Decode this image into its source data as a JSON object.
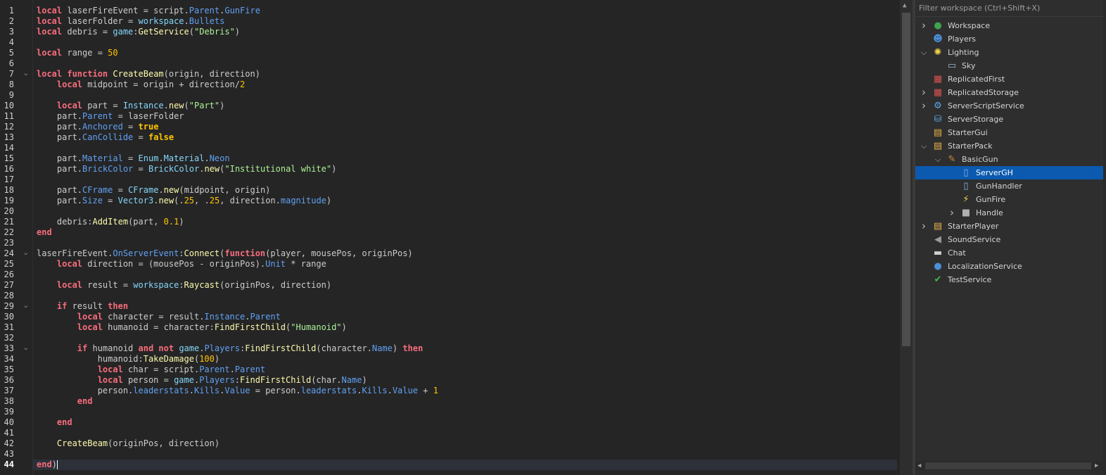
{
  "editor": {
    "current_line": 44,
    "lines": [
      {
        "n": 1,
        "code": [
          [
            "kw",
            "local"
          ],
          [
            "op",
            " laserFireEvent = script."
          ],
          [
            "prop",
            "Parent"
          ],
          [
            "op",
            "."
          ],
          [
            "prop",
            "GunFire"
          ]
        ]
      },
      {
        "n": 2,
        "code": [
          [
            "kw",
            "local"
          ],
          [
            "op",
            " laserFolder = "
          ],
          [
            "builtin",
            "workspace"
          ],
          [
            "op",
            "."
          ],
          [
            "prop",
            "Bullets"
          ]
        ]
      },
      {
        "n": 3,
        "code": [
          [
            "kw",
            "local"
          ],
          [
            "op",
            " debris = "
          ],
          [
            "builtin",
            "game"
          ],
          [
            "op",
            ":"
          ],
          [
            "fn",
            "GetService"
          ],
          [
            "op",
            "("
          ],
          [
            "str",
            "\"Debris\""
          ],
          [
            "op",
            ")"
          ]
        ]
      },
      {
        "n": 4,
        "code": []
      },
      {
        "n": 5,
        "code": [
          [
            "kw",
            "local"
          ],
          [
            "op",
            " range = "
          ],
          [
            "num",
            "50"
          ]
        ]
      },
      {
        "n": 6,
        "code": []
      },
      {
        "n": 7,
        "fold": true,
        "code": [
          [
            "kw",
            "local function"
          ],
          [
            "op",
            " "
          ],
          [
            "fn",
            "CreateBeam"
          ],
          [
            "op",
            "(origin, direction)"
          ]
        ]
      },
      {
        "n": 8,
        "code": [
          [
            "op",
            "    "
          ],
          [
            "kw",
            "local"
          ],
          [
            "op",
            " midpoint = origin + direction/"
          ],
          [
            "num",
            "2"
          ]
        ]
      },
      {
        "n": 9,
        "code": []
      },
      {
        "n": 10,
        "code": [
          [
            "op",
            "    "
          ],
          [
            "kw",
            "local"
          ],
          [
            "op",
            " part = "
          ],
          [
            "builtin",
            "Instance"
          ],
          [
            "op",
            "."
          ],
          [
            "fn",
            "new"
          ],
          [
            "op",
            "("
          ],
          [
            "str",
            "\"Part\""
          ],
          [
            "op",
            ")"
          ]
        ]
      },
      {
        "n": 11,
        "code": [
          [
            "op",
            "    part."
          ],
          [
            "prop",
            "Parent"
          ],
          [
            "op",
            " = laserFolder"
          ]
        ]
      },
      {
        "n": 12,
        "code": [
          [
            "op",
            "    part."
          ],
          [
            "prop",
            "Anchored"
          ],
          [
            "op",
            " = "
          ],
          [
            "bool",
            "true"
          ]
        ]
      },
      {
        "n": 13,
        "code": [
          [
            "op",
            "    part."
          ],
          [
            "prop",
            "CanCollide"
          ],
          [
            "op",
            " = "
          ],
          [
            "bool",
            "false"
          ]
        ]
      },
      {
        "n": 14,
        "code": []
      },
      {
        "n": 15,
        "code": [
          [
            "op",
            "    part."
          ],
          [
            "prop",
            "Material"
          ],
          [
            "op",
            " = "
          ],
          [
            "builtin",
            "Enum"
          ],
          [
            "op",
            "."
          ],
          [
            "builtin",
            "Material"
          ],
          [
            "op",
            "."
          ],
          [
            "prop",
            "Neon"
          ]
        ]
      },
      {
        "n": 16,
        "code": [
          [
            "op",
            "    part."
          ],
          [
            "prop",
            "BrickColor"
          ],
          [
            "op",
            " = "
          ],
          [
            "builtin",
            "BrickColor"
          ],
          [
            "op",
            "."
          ],
          [
            "fn",
            "new"
          ],
          [
            "op",
            "("
          ],
          [
            "str",
            "\"Institutional white\""
          ],
          [
            "op",
            ")"
          ]
        ]
      },
      {
        "n": 17,
        "code": []
      },
      {
        "n": 18,
        "code": [
          [
            "op",
            "    part."
          ],
          [
            "prop",
            "CFrame"
          ],
          [
            "op",
            " = "
          ],
          [
            "builtin",
            "CFrame"
          ],
          [
            "op",
            "."
          ],
          [
            "fn",
            "new"
          ],
          [
            "op",
            "(midpoint, origin)"
          ]
        ]
      },
      {
        "n": 19,
        "code": [
          [
            "op",
            "    part."
          ],
          [
            "prop",
            "Size"
          ],
          [
            "op",
            " = "
          ],
          [
            "builtin",
            "Vector3"
          ],
          [
            "op",
            "."
          ],
          [
            "fn",
            "new"
          ],
          [
            "op",
            "(."
          ],
          [
            "num",
            "25"
          ],
          [
            "op",
            ", ."
          ],
          [
            "num",
            "25"
          ],
          [
            "op",
            ", direction."
          ],
          [
            "prop",
            "magnitude"
          ],
          [
            "op",
            ")"
          ]
        ]
      },
      {
        "n": 20,
        "code": []
      },
      {
        "n": 21,
        "code": [
          [
            "op",
            "    debris:"
          ],
          [
            "fn",
            "AddItem"
          ],
          [
            "op",
            "(part, "
          ],
          [
            "num",
            "0.1"
          ],
          [
            "op",
            ")"
          ]
        ]
      },
      {
        "n": 22,
        "code": [
          [
            "kw",
            "end"
          ]
        ]
      },
      {
        "n": 23,
        "code": []
      },
      {
        "n": 24,
        "fold": true,
        "code": [
          [
            "op",
            "laserFireEvent."
          ],
          [
            "prop",
            "OnServerEvent"
          ],
          [
            "op",
            ":"
          ],
          [
            "fn",
            "Connect"
          ],
          [
            "op",
            "("
          ],
          [
            "kw",
            "function"
          ],
          [
            "op",
            "(player, mousePos, originPos)"
          ]
        ]
      },
      {
        "n": 25,
        "code": [
          [
            "op",
            "    "
          ],
          [
            "kw",
            "local"
          ],
          [
            "op",
            " direction = (mousePos - originPos)."
          ],
          [
            "prop",
            "Unit"
          ],
          [
            "op",
            " * range"
          ]
        ]
      },
      {
        "n": 26,
        "code": []
      },
      {
        "n": 27,
        "code": [
          [
            "op",
            "    "
          ],
          [
            "kw",
            "local"
          ],
          [
            "op",
            " result = "
          ],
          [
            "builtin",
            "workspace"
          ],
          [
            "op",
            ":"
          ],
          [
            "fn",
            "Raycast"
          ],
          [
            "op",
            "(originPos, direction)"
          ]
        ]
      },
      {
        "n": 28,
        "code": []
      },
      {
        "n": 29,
        "fold": true,
        "code": [
          [
            "op",
            "    "
          ],
          [
            "kw",
            "if"
          ],
          [
            "op",
            " result "
          ],
          [
            "kw",
            "then"
          ]
        ]
      },
      {
        "n": 30,
        "code": [
          [
            "op",
            "        "
          ],
          [
            "kw",
            "local"
          ],
          [
            "op",
            " character = result."
          ],
          [
            "prop",
            "Instance"
          ],
          [
            "op",
            "."
          ],
          [
            "prop",
            "Parent"
          ]
        ]
      },
      {
        "n": 31,
        "code": [
          [
            "op",
            "        "
          ],
          [
            "kw",
            "local"
          ],
          [
            "op",
            " humanoid = character:"
          ],
          [
            "fn",
            "FindFirstChild"
          ],
          [
            "op",
            "("
          ],
          [
            "str",
            "\"Humanoid\""
          ],
          [
            "op",
            ")"
          ]
        ]
      },
      {
        "n": 32,
        "code": []
      },
      {
        "n": 33,
        "fold": true,
        "code": [
          [
            "op",
            "        "
          ],
          [
            "kw",
            "if"
          ],
          [
            "op",
            " humanoid "
          ],
          [
            "kw",
            "and not"
          ],
          [
            "op",
            " "
          ],
          [
            "builtin",
            "game"
          ],
          [
            "op",
            "."
          ],
          [
            "prop",
            "Players"
          ],
          [
            "op",
            ":"
          ],
          [
            "fn",
            "FindFirstChild"
          ],
          [
            "op",
            "(character."
          ],
          [
            "prop",
            "Name"
          ],
          [
            "op",
            ") "
          ],
          [
            "kw",
            "then"
          ]
        ]
      },
      {
        "n": 34,
        "code": [
          [
            "op",
            "            humanoid:"
          ],
          [
            "fn",
            "TakeDamage"
          ],
          [
            "op",
            "("
          ],
          [
            "num",
            "100"
          ],
          [
            "op",
            ")"
          ]
        ]
      },
      {
        "n": 35,
        "code": [
          [
            "op",
            "            "
          ],
          [
            "kw",
            "local"
          ],
          [
            "op",
            " char = script."
          ],
          [
            "prop",
            "Parent"
          ],
          [
            "op",
            "."
          ],
          [
            "prop",
            "Parent"
          ]
        ]
      },
      {
        "n": 36,
        "code": [
          [
            "op",
            "            "
          ],
          [
            "kw",
            "local"
          ],
          [
            "op",
            " person = "
          ],
          [
            "builtin",
            "game"
          ],
          [
            "op",
            "."
          ],
          [
            "prop",
            "Players"
          ],
          [
            "op",
            ":"
          ],
          [
            "fn",
            "FindFirstChild"
          ],
          [
            "op",
            "(char."
          ],
          [
            "prop",
            "Name"
          ],
          [
            "op",
            ")"
          ]
        ]
      },
      {
        "n": 37,
        "code": [
          [
            "op",
            "            person."
          ],
          [
            "prop",
            "leaderstats"
          ],
          [
            "op",
            "."
          ],
          [
            "prop",
            "Kills"
          ],
          [
            "op",
            "."
          ],
          [
            "prop",
            "Value"
          ],
          [
            "op",
            " = person."
          ],
          [
            "prop",
            "leaderstats"
          ],
          [
            "op",
            "."
          ],
          [
            "prop",
            "Kills"
          ],
          [
            "op",
            "."
          ],
          [
            "prop",
            "Value"
          ],
          [
            "op",
            " + "
          ],
          [
            "num",
            "1"
          ]
        ]
      },
      {
        "n": 38,
        "code": [
          [
            "op",
            "        "
          ],
          [
            "kw",
            "end"
          ]
        ]
      },
      {
        "n": 39,
        "code": []
      },
      {
        "n": 40,
        "code": [
          [
            "op",
            "    "
          ],
          [
            "kw",
            "end"
          ]
        ]
      },
      {
        "n": 41,
        "code": []
      },
      {
        "n": 42,
        "code": [
          [
            "op",
            "    "
          ],
          [
            "fn",
            "CreateBeam"
          ],
          [
            "op",
            "(originPos, direction)"
          ]
        ]
      },
      {
        "n": 43,
        "code": []
      },
      {
        "n": 44,
        "code": [
          [
            "kw",
            "end"
          ],
          [
            "op",
            ")"
          ]
        ]
      }
    ]
  },
  "explorer": {
    "filter_placeholder": "Filter workspace (Ctrl+Shift+X)",
    "selected": "ServerGH",
    "items": [
      {
        "label": "Workspace",
        "depth": 0,
        "chevron": "collapsed",
        "icon": "workspace-icon",
        "color": "#3fa34d"
      },
      {
        "label": "Players",
        "depth": 0,
        "chevron": "none",
        "icon": "players-icon",
        "color": "#4a90d9"
      },
      {
        "label": "Lighting",
        "depth": 0,
        "chevron": "expanded",
        "icon": "lighting-icon",
        "color": "#f5d547"
      },
      {
        "label": "Sky",
        "depth": 1,
        "chevron": "none",
        "icon": "sky-icon",
        "color": "#9fb8cf"
      },
      {
        "label": "ReplicatedFirst",
        "depth": 0,
        "chevron": "none",
        "icon": "replicated-first-icon",
        "color": "#d9534f"
      },
      {
        "label": "ReplicatedStorage",
        "depth": 0,
        "chevron": "collapsed",
        "icon": "replicated-storage-icon",
        "color": "#d9534f"
      },
      {
        "label": "ServerScriptService",
        "depth": 0,
        "chevron": "collapsed",
        "icon": "server-script-service-icon",
        "color": "#5aa9e6"
      },
      {
        "label": "ServerStorage",
        "depth": 0,
        "chevron": "none",
        "icon": "server-storage-icon",
        "color": "#5aa9e6"
      },
      {
        "label": "StarterGui",
        "depth": 0,
        "chevron": "none",
        "icon": "starter-gui-icon",
        "color": "#e8b04a"
      },
      {
        "label": "StarterPack",
        "depth": 0,
        "chevron": "expanded",
        "icon": "starter-pack-icon",
        "color": "#e8b04a"
      },
      {
        "label": "BasicGun",
        "depth": 1,
        "chevron": "expanded",
        "icon": "tool-icon",
        "color": "#c88a3a"
      },
      {
        "label": "ServerGH",
        "depth": 2,
        "chevron": "none",
        "icon": "script-icon",
        "color": "#7fb3f0"
      },
      {
        "label": "GunHandler",
        "depth": 2,
        "chevron": "none",
        "icon": "local-script-icon",
        "color": "#7fb3f0"
      },
      {
        "label": "GunFire",
        "depth": 2,
        "chevron": "none",
        "icon": "remote-event-icon",
        "color": "#f0d04a"
      },
      {
        "label": "Handle",
        "depth": 2,
        "chevron": "collapsed",
        "icon": "part-icon",
        "color": "#b0b0b0"
      },
      {
        "label": "StarterPlayer",
        "depth": 0,
        "chevron": "collapsed",
        "icon": "starter-player-icon",
        "color": "#e8b04a"
      },
      {
        "label": "SoundService",
        "depth": 0,
        "chevron": "none",
        "icon": "sound-service-icon",
        "color": "#9a9a9a"
      },
      {
        "label": "Chat",
        "depth": 0,
        "chevron": "none",
        "icon": "chat-icon",
        "color": "#d0d0d0"
      },
      {
        "label": "LocalizationService",
        "depth": 0,
        "chevron": "none",
        "icon": "localization-icon",
        "color": "#4a90d9"
      },
      {
        "label": "TestService",
        "depth": 0,
        "chevron": "none",
        "icon": "test-service-icon",
        "color": "#3fb950"
      }
    ]
  }
}
